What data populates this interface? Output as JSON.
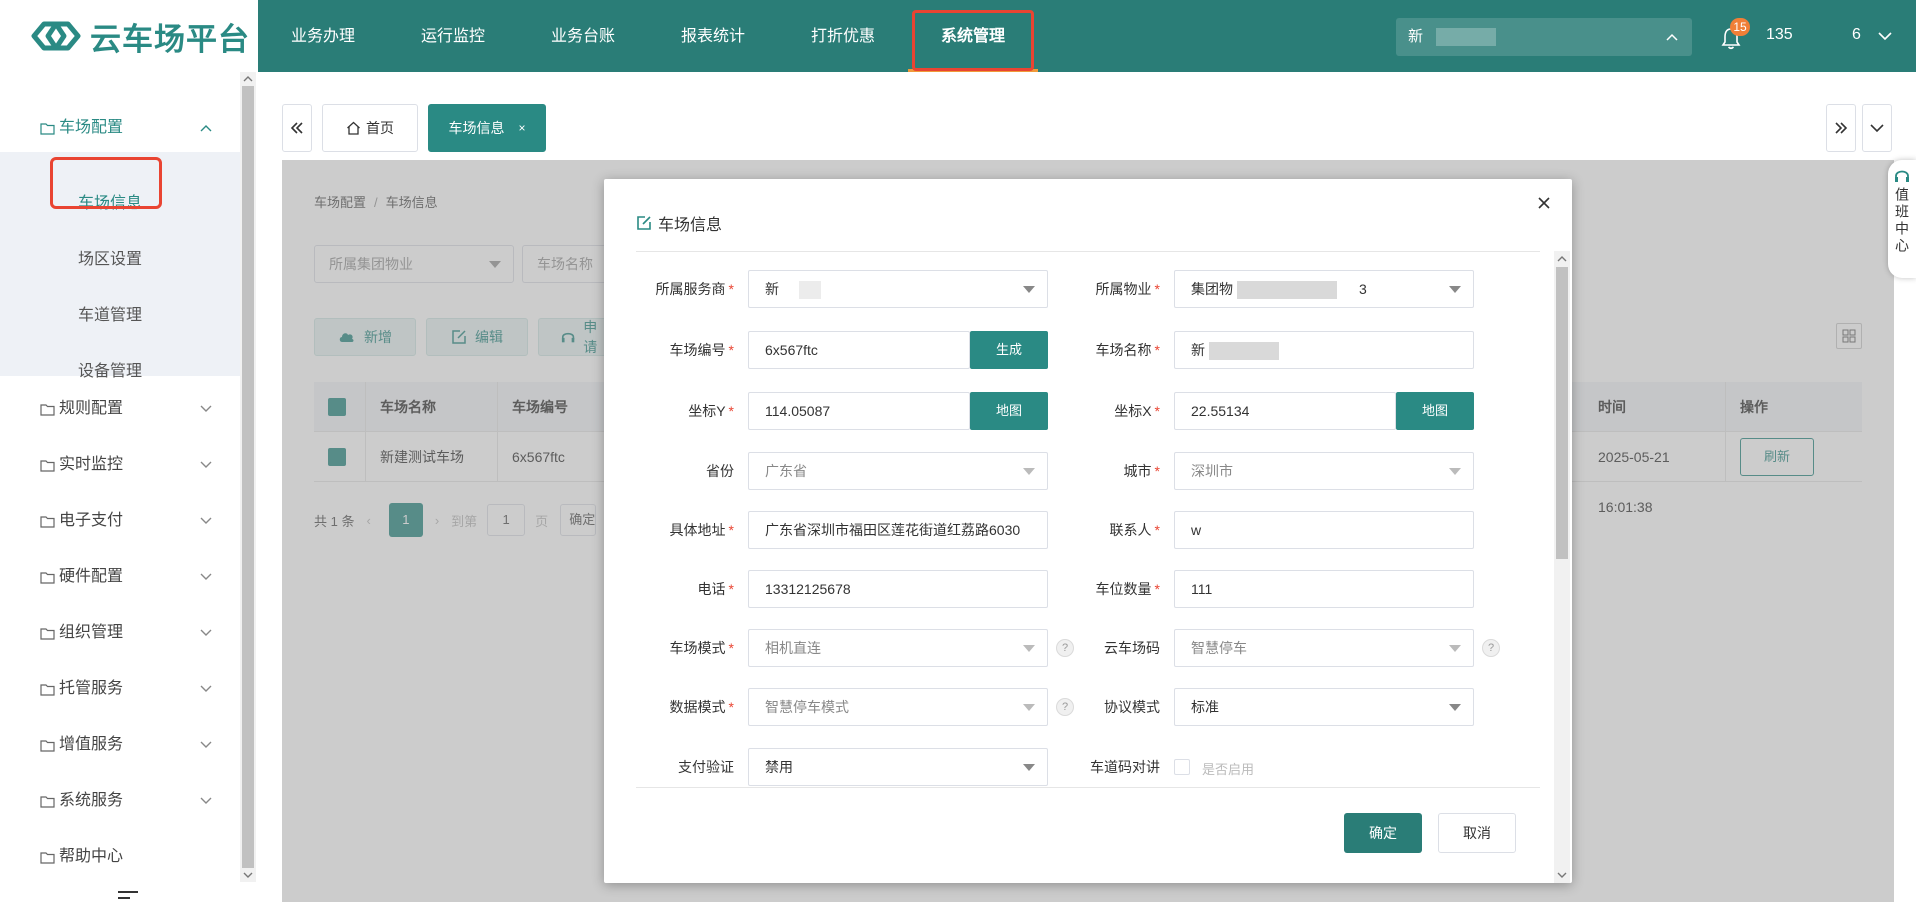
{
  "brand": {
    "name": "云车场平台",
    "accent": "#2a7d77",
    "highlight": "#e94432"
  },
  "topnav": {
    "items": [
      "业务办理",
      "运行监控",
      "业务台账",
      "报表统计",
      "打折优惠",
      "系统管理"
    ],
    "active": "系统管理",
    "project_select": "新",
    "notification_count": "15",
    "user_name": "135",
    "user_tail": "6"
  },
  "sidebar": {
    "groups": [
      {
        "label": "车场配置",
        "expanded": true,
        "children": [
          "车场信息",
          "场区设置",
          "车道管理",
          "设备管理"
        ],
        "active_child": "车场信息"
      },
      {
        "label": "规则配置"
      },
      {
        "label": "实时监控"
      },
      {
        "label": "电子支付"
      },
      {
        "label": "硬件配置"
      },
      {
        "label": "组织管理"
      },
      {
        "label": "托管服务"
      },
      {
        "label": "增值服务"
      },
      {
        "label": "系统服务"
      },
      {
        "label": "帮助中心"
      }
    ]
  },
  "tabs": {
    "home": "首页",
    "current": "车场信息",
    "close": "×"
  },
  "breadcrumb": [
    "车场配置",
    "车场信息"
  ],
  "breadcrumb_sep": "/",
  "filters": {
    "group_placeholder": "所属集团物业",
    "name_placeholder": "车场名称"
  },
  "actions": {
    "add": "新增",
    "edit": "编辑",
    "apply": "申请"
  },
  "table": {
    "headers": {
      "name": "车场名称",
      "code": "车场编号",
      "time": "时间",
      "op": "操作"
    },
    "row": {
      "name": "新建测试车场",
      "code": "6x567ftc",
      "time": "2025-05-21 16:01:38",
      "op": "刷新"
    }
  },
  "pager": {
    "total": "共 1 条",
    "page": "1",
    "goto": "到第",
    "goto_value": "1",
    "page_unit": "页",
    "confirm": "确定"
  },
  "duty_center": "值班中心",
  "dialog": {
    "title": "车场信息",
    "fields": {
      "provider": {
        "label": "所属服务商",
        "value": "新"
      },
      "property": {
        "label": "所属物业",
        "value": "集团物",
        "value_tail": "3"
      },
      "code": {
        "label": "车场编号",
        "value": "6x567ftc",
        "button": "生成"
      },
      "name": {
        "label": "车场名称",
        "value": "新"
      },
      "lat": {
        "label": "坐标Y",
        "value": "114.05087",
        "button": "地图"
      },
      "lng": {
        "label": "坐标X",
        "value": "22.55134",
        "button": "地图"
      },
      "province": {
        "label": "省份",
        "value": "广东省"
      },
      "city": {
        "label": "城市",
        "value": "深圳市"
      },
      "address": {
        "label": "具体地址",
        "value": "广东省深圳市福田区莲花街道红荔路6030"
      },
      "contact": {
        "label": "联系人",
        "value": "w"
      },
      "phone": {
        "label": "电话",
        "value": "13312125678"
      },
      "spaces": {
        "label": "车位数量",
        "value": "111"
      },
      "mode": {
        "label": "车场模式",
        "value": "相机直连"
      },
      "cloud_code": {
        "label": "云车场码",
        "value": "智慧停车"
      },
      "data_mode": {
        "label": "数据模式",
        "value": "智慧停车模式"
      },
      "protocol": {
        "label": "协议模式",
        "value": "标准"
      },
      "pay_verify": {
        "label": "支付验证",
        "value": "禁用"
      },
      "intercom": {
        "label": "车道码对讲",
        "value": "是否启用"
      }
    },
    "help": "?",
    "ok": "确定",
    "cancel": "取消"
  }
}
